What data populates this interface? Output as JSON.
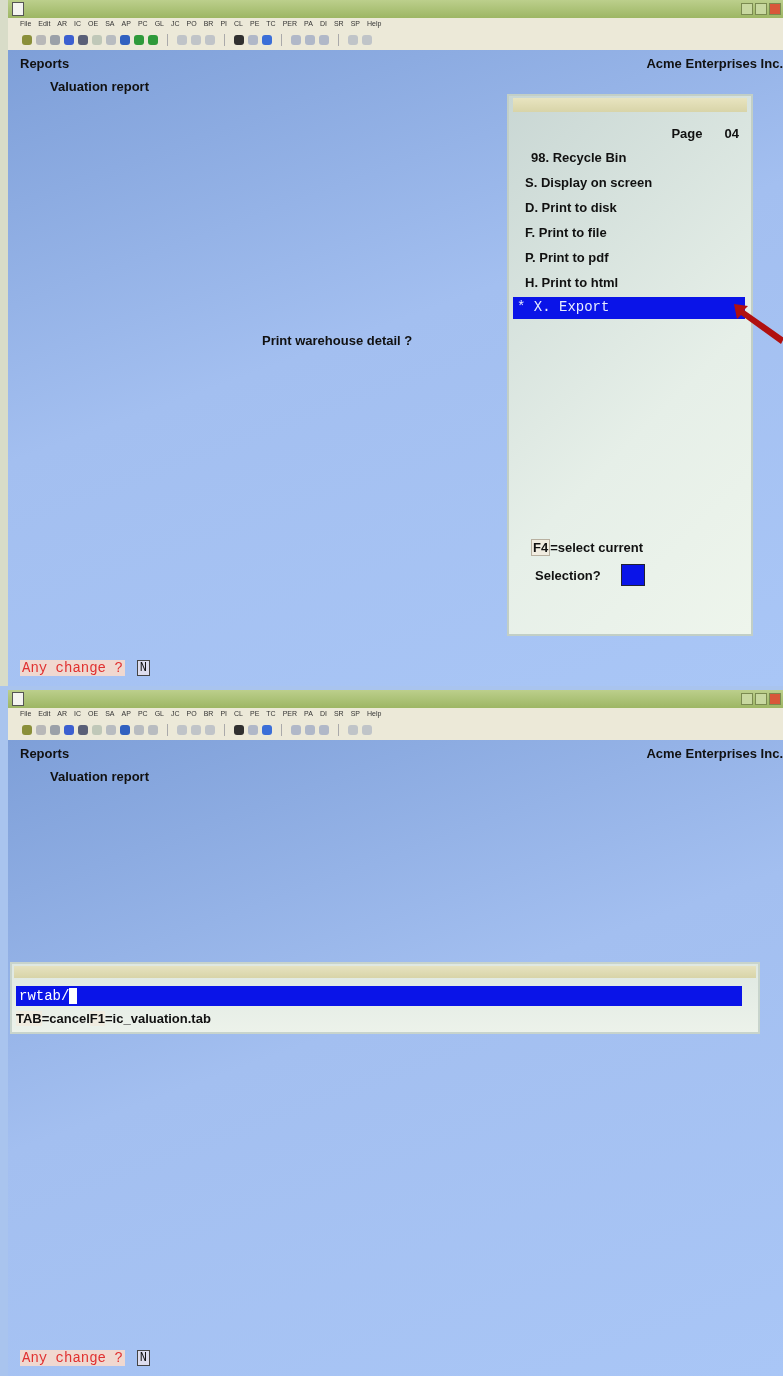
{
  "screens": [
    {
      "kind": "menu",
      "menubar": [
        "File",
        "Edit",
        "AR",
        "IC",
        "OE",
        "SA",
        "AP",
        "PC",
        "GL",
        "JC",
        "PO",
        "BR",
        "PI",
        "CL",
        "PE",
        "TC",
        "PER",
        "PA",
        "DI",
        "SR",
        "SP",
        "Help"
      ],
      "header": {
        "module": "Reports",
        "company": "Acme Enterprises Inc.",
        "report": "Valuation report"
      },
      "prompt": "Print warehouse detail ?",
      "popup": {
        "page_label": "Page",
        "page": "04",
        "items": [
          {
            "label": "98. Recycle Bin",
            "selected": false
          },
          {
            "label": "S. Display on screen",
            "selected": false
          },
          {
            "label": "D. Print to disk",
            "selected": false
          },
          {
            "label": "F. Print to file",
            "selected": false
          },
          {
            "label": "P. Print to pdf",
            "selected": false
          },
          {
            "label": "H. Print to html",
            "selected": false
          },
          {
            "label": "* X. Export",
            "selected": true
          }
        ],
        "hint_key": "F4",
        "hint_text": "=select current",
        "selection_label": "Selection?"
      },
      "footer": {
        "label": "Any change ?",
        "value": "N"
      }
    },
    {
      "kind": "input",
      "menubar": [
        "File",
        "Edit",
        "AR",
        "IC",
        "OE",
        "SA",
        "AP",
        "PC",
        "GL",
        "JC",
        "PO",
        "BR",
        "PI",
        "CL",
        "PE",
        "TC",
        "PER",
        "PA",
        "DI",
        "SR",
        "SP",
        "Help"
      ],
      "header": {
        "module": "Reports",
        "company": "Acme Enterprises Inc.",
        "report": "Valuation report"
      },
      "dialog": {
        "value": "rwtab/",
        "hints": [
          {
            "key": "TAB",
            "text": "=cancel"
          },
          {
            "key": "F1",
            "text": "=ic_valuation.tab"
          }
        ]
      },
      "footer": {
        "label": "Any change ?",
        "value": "N"
      }
    }
  ]
}
